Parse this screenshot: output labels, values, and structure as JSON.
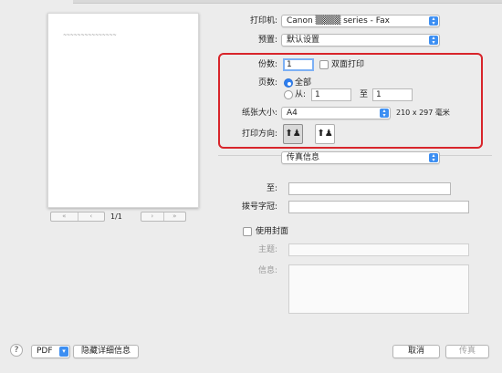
{
  "printer": {
    "label": "打印机:",
    "value": "Canon ▒▒▒▒ series - Fax"
  },
  "presets": {
    "label": "预置:",
    "value": "默认设置"
  },
  "copies": {
    "label": "份数:",
    "value": "1",
    "duplex_label": "双面打印"
  },
  "pages": {
    "label": "页数:",
    "all_label": "全部",
    "from_label": "从:",
    "from_value": "1",
    "to_label": "至",
    "to_value": "1"
  },
  "paper_size": {
    "label": "纸张大小:",
    "value": "A4",
    "dimensions": "210 x 297 毫米"
  },
  "orientation": {
    "label": "打印方向:"
  },
  "section_popup": {
    "value": "传真信息"
  },
  "fax": {
    "to_label": "至:",
    "prefix_label": "拨号字冠:",
    "cover_label": "使用封面",
    "subject_label": "主题:",
    "message_label": "信息:"
  },
  "preview": {
    "page_indicator": "1/1",
    "scribble": "~~~~~~~~~~~~~~~"
  },
  "bottom": {
    "help": "?",
    "pdf_label": "PDF",
    "hide_details": "隐藏详细信息",
    "cancel": "取消",
    "fax_button": "传真"
  },
  "colors": {
    "accent": "#3d8ff2",
    "highlight_box": "#d8252b"
  }
}
